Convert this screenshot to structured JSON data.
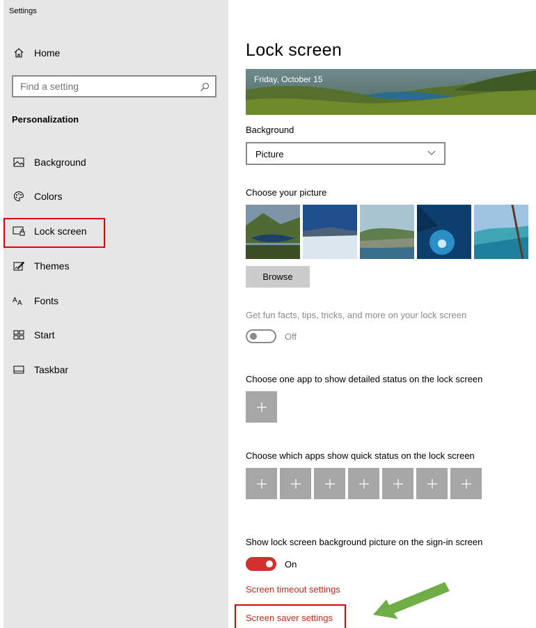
{
  "app": {
    "title": "Settings"
  },
  "sidebar": {
    "home_label": "Home",
    "search": {
      "placeholder": "Find a setting"
    },
    "section_title": "Personalization",
    "items": [
      {
        "label": "Background",
        "icon": "background-icon"
      },
      {
        "label": "Colors",
        "icon": "palette-icon"
      },
      {
        "label": "Lock screen",
        "icon": "lock-screen-icon",
        "selected": true
      },
      {
        "label": "Themes",
        "icon": "themes-icon"
      },
      {
        "label": "Fonts",
        "icon": "fonts-icon"
      },
      {
        "label": "Start",
        "icon": "start-icon"
      },
      {
        "label": "Taskbar",
        "icon": "taskbar-icon"
      }
    ]
  },
  "main": {
    "title": "Lock screen",
    "preview_date": "Friday, October 15",
    "background_label": "Background",
    "background_value": "Picture",
    "choose_picture_label": "Choose your picture",
    "browse_label": "Browse",
    "fun_facts_label": "Get fun facts, tips, tricks, and more on your lock screen",
    "fun_facts_toggle": {
      "state": "Off",
      "on": false
    },
    "detailed_status_label": "Choose one app to show detailed status on the lock screen",
    "quick_status_label": "Choose which apps show quick status on the lock screen",
    "quick_status_slots": 7,
    "signin_label": "Show lock screen background picture on the sign-in screen",
    "signin_toggle": {
      "state": "On",
      "on": true
    },
    "timeout_link": "Screen timeout settings",
    "saver_link": "Screen saver settings"
  },
  "colors": {
    "accent": "#d32f2f",
    "link": "#c42b1c",
    "highlight_box": "#e00000",
    "arrow": "#70ad47",
    "sidebar_bg": "#e6e6e6",
    "tile_bg": "#a6a6a6"
  }
}
